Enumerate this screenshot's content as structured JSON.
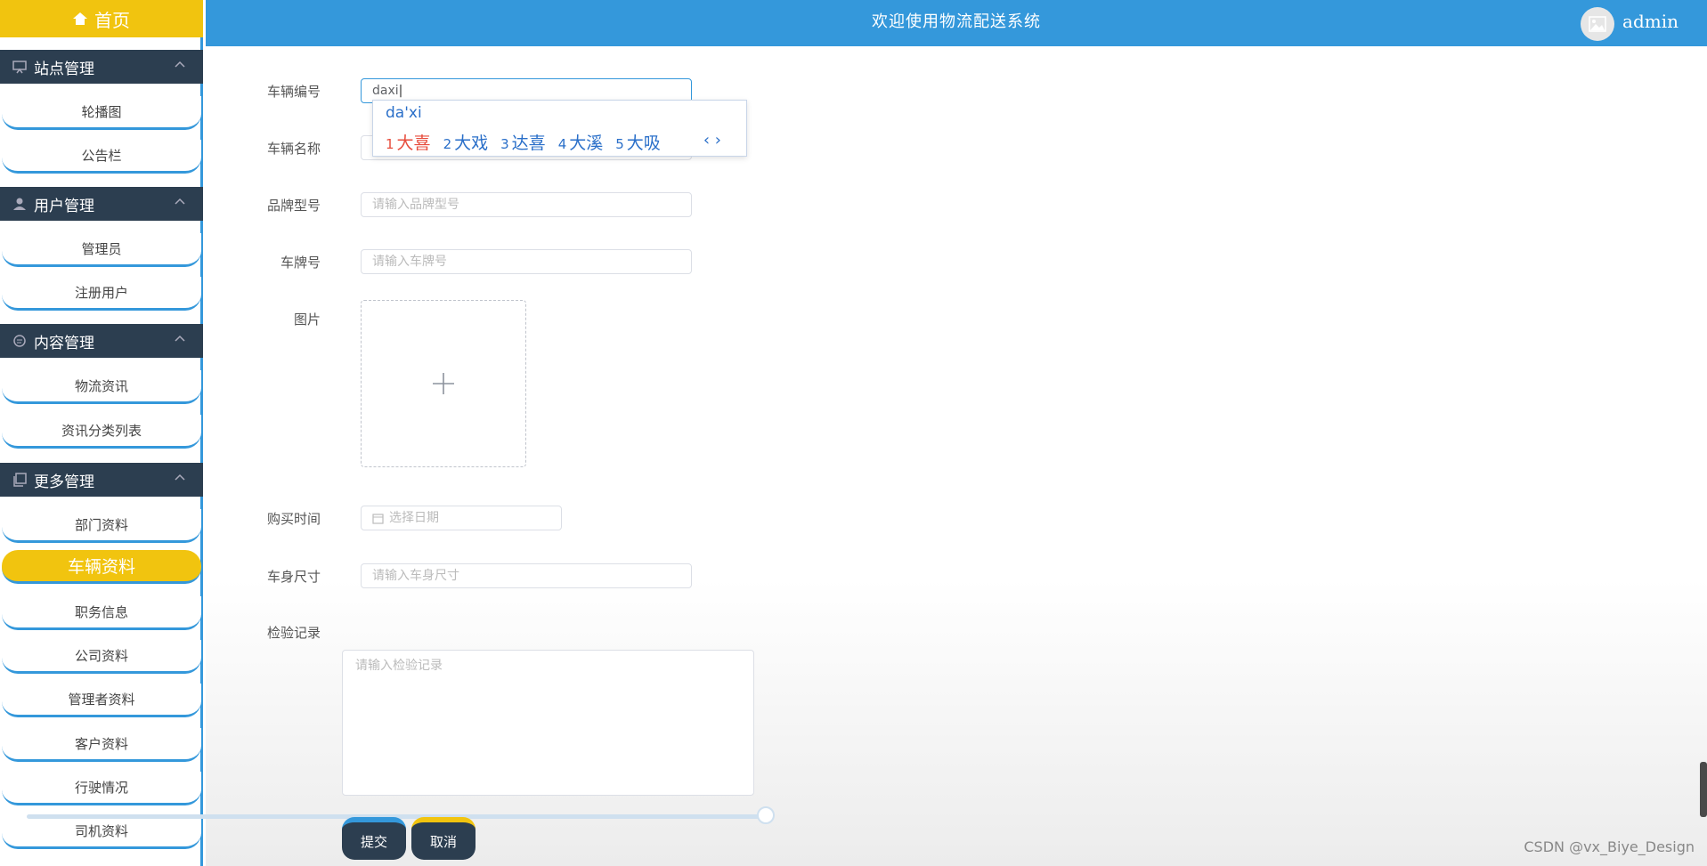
{
  "sidebar": {
    "home_label": "首页",
    "groups": [
      {
        "title": "站点管理",
        "items": [
          "轮播图",
          "公告栏"
        ]
      },
      {
        "title": "用户管理",
        "items": [
          "管理员",
          "注册用户"
        ]
      },
      {
        "title": "内容管理",
        "items": [
          "物流资讯",
          "资讯分类列表"
        ]
      },
      {
        "title": "更多管理",
        "items": [
          "部门资料",
          "车辆资料",
          "职务信息",
          "公司资料",
          "管理者资料",
          "客户资料",
          "行驶情况",
          "司机资料"
        ]
      }
    ],
    "active_item": "车辆资料"
  },
  "header": {
    "title": "欢迎使用物流配送系统",
    "username": "admin"
  },
  "form": {
    "vehicle_no_label": "车辆编号",
    "vehicle_no_value": "daxi",
    "vehicle_name_label": "车辆名称",
    "brand_model_label": "品牌型号",
    "brand_model_placeholder": "请输入品牌型号",
    "plate_no_label": "车牌号",
    "plate_no_placeholder": "请输入车牌号",
    "image_label": "图片",
    "purchase_time_label": "购买时间",
    "purchase_time_placeholder": "选择日期",
    "body_size_label": "车身尺寸",
    "body_size_placeholder": "请输入车身尺寸",
    "inspection_label": "检验记录",
    "inspection_placeholder": "请输入检验记录",
    "submit_label": "提交",
    "cancel_label": "取消"
  },
  "ime": {
    "composition": "da'xi",
    "candidates": [
      {
        "num": "1",
        "text": "大喜"
      },
      {
        "num": "2",
        "text": "大戏"
      },
      {
        "num": "3",
        "text": "达喜"
      },
      {
        "num": "4",
        "text": "大溪"
      },
      {
        "num": "5",
        "text": "大吸"
      }
    ],
    "nav": "‹ ›"
  },
  "watermark": "CSDN @vx_Biye_Design",
  "colors": {
    "primary": "#3498db",
    "accent": "#f1c40f",
    "dark": "#2c3e50"
  }
}
